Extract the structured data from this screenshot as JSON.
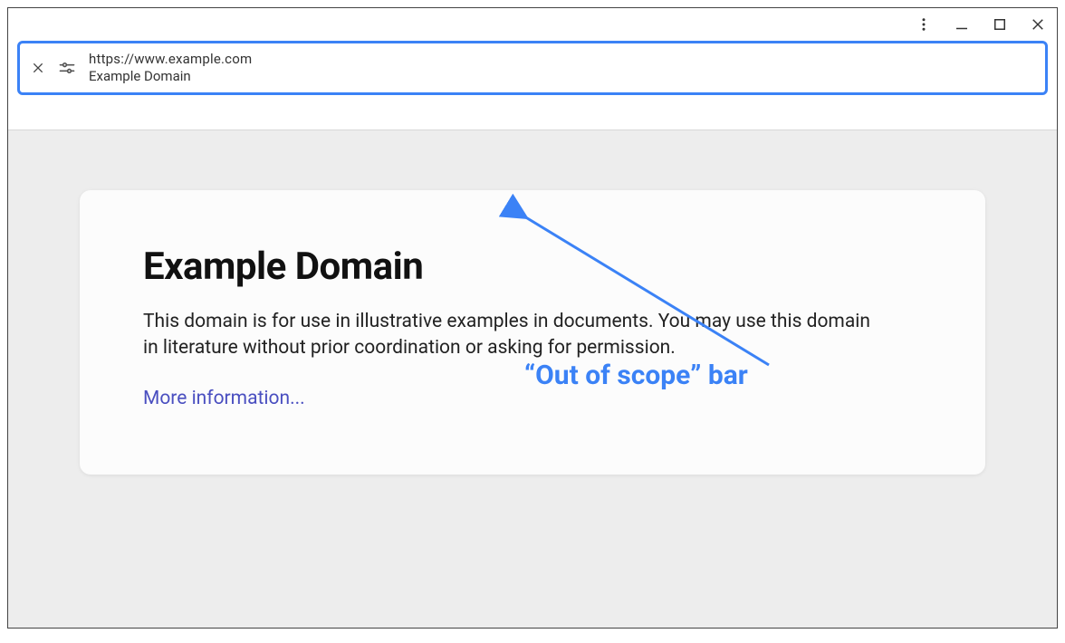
{
  "window": {
    "controls": {
      "more": "more",
      "minimize": "minimize",
      "maximize": "maximize",
      "close": "close"
    }
  },
  "addressbar": {
    "url": "https://www.example.com",
    "page_title": "Example Domain"
  },
  "page": {
    "heading": "Example Domain",
    "body": "This domain is for use in illustrative examples in documents. You may use this domain in literature without prior coordination or asking for permission.",
    "link_label": "More information..."
  },
  "annotation": {
    "label": "“Out of scope” bar"
  },
  "colors": {
    "highlight": "#3b82f6",
    "link": "#4a4fc0"
  }
}
